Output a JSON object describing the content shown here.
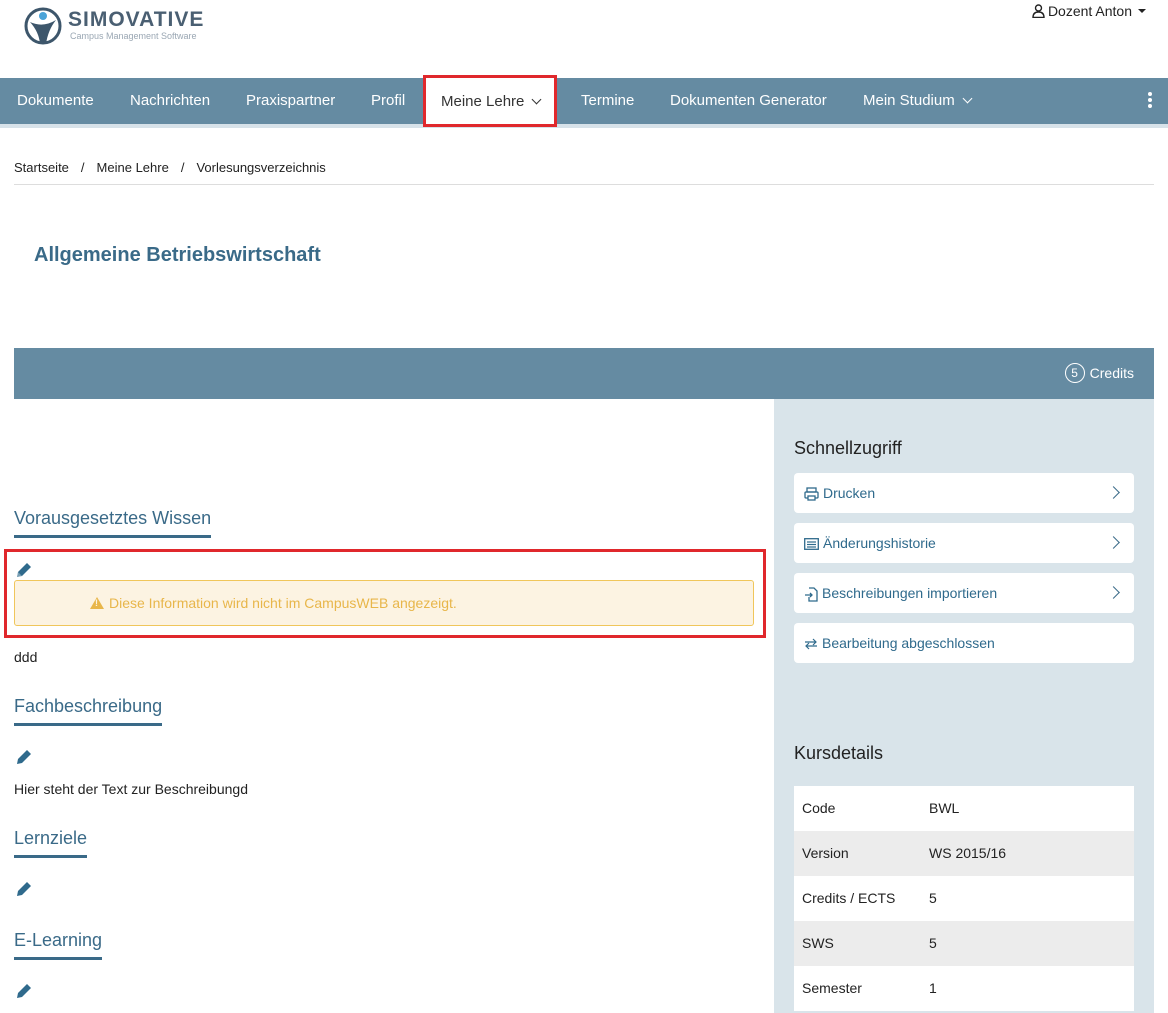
{
  "brand": {
    "name": "SIMOVATIVE",
    "tagline": "Campus Management Software"
  },
  "user": {
    "label": "Dozent Anton"
  },
  "nav": {
    "items": [
      {
        "label": "Dokumente"
      },
      {
        "label": "Nachrichten"
      },
      {
        "label": "Praxispartner"
      },
      {
        "label": "Profil"
      },
      {
        "label": "Meine Lehre"
      },
      {
        "label": "Termine"
      },
      {
        "label": "Dokumenten Generator"
      },
      {
        "label": "Mein Studium"
      }
    ]
  },
  "breadcrumb": [
    "Startseite",
    "Meine Lehre",
    "Vorlesungsverzeichnis"
  ],
  "page": {
    "title": "Allgemeine Betriebswirtschaft"
  },
  "credits": {
    "count": "5",
    "label": "Credits"
  },
  "sections": {
    "vorwissen": {
      "title": "Vorausgesetztes Wissen",
      "alert": "Diese Information wird nicht im CampusWEB angezeigt.",
      "text": "ddd"
    },
    "fach": {
      "title": "Fachbeschreibung",
      "text": "Hier steht der Text zur Beschreibungd"
    },
    "lernziele": {
      "title": "Lernziele"
    },
    "elearning": {
      "title": "E-Learning"
    }
  },
  "sidebar": {
    "quick_title": "Schnellzugriff",
    "quick_links": [
      {
        "label": "Drucken",
        "icon": "printer-icon"
      },
      {
        "label": "Änderungshistorie",
        "icon": "list-icon"
      },
      {
        "label": "Beschreibungen importieren",
        "icon": "import-icon"
      },
      {
        "label": "Bearbeitung abgeschlossen",
        "icon": "exchange-icon"
      }
    ],
    "details_title": "Kursdetails",
    "details": [
      {
        "key": "Code",
        "value": "BWL"
      },
      {
        "key": "Version",
        "value": "WS 2015/16"
      },
      {
        "key": "Credits / ECTS",
        "value": "5"
      },
      {
        "key": "SWS",
        "value": "5"
      },
      {
        "key": "Semester",
        "value": "1"
      }
    ]
  },
  "colors": {
    "nav": "#658ba2",
    "accent": "#3a6a88",
    "highlight": "#e0282c",
    "warning": "#e8b64a"
  }
}
